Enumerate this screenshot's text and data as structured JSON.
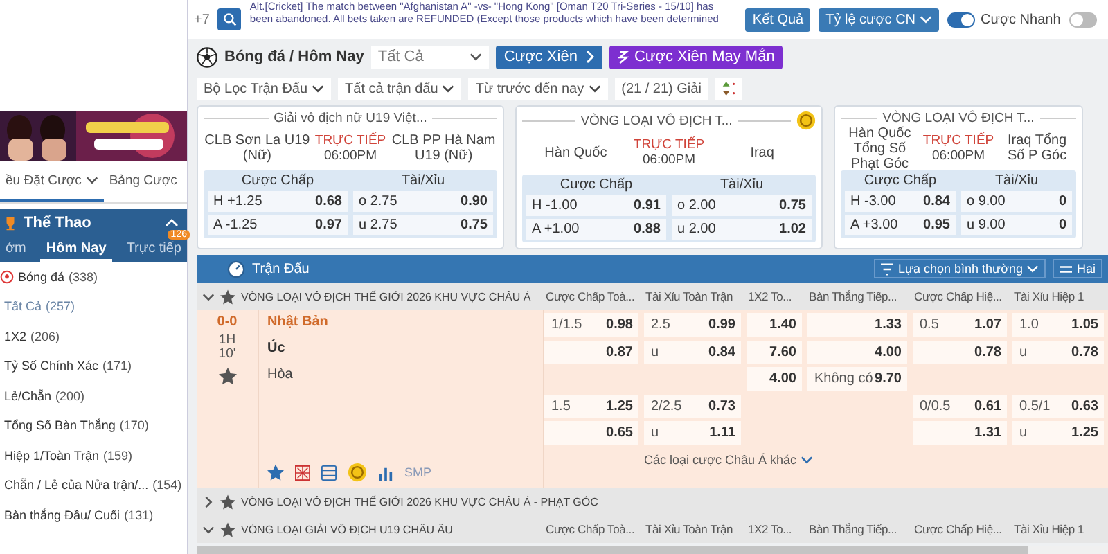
{
  "top_bar": {
    "more_count": "+7",
    "ticker": "Alt.[Cricket] The match between \"Afghanistan A\" -vs- \"Hong Kong\" [Oman T20 Tri-Series - 15/10] has been abandoned. All bets taken are REFUNDED (Except those products which have been determined",
    "buttons": [
      {
        "label": "Kết Quả",
        "kind": "plain"
      },
      {
        "label": "Tỷ lệ cược CN",
        "kind": "dropdown"
      }
    ],
    "toggles": [
      {
        "label": "Cược Nhanh",
        "on": true
      },
      {
        "on": false
      }
    ]
  },
  "sidebar": {
    "tabs": [
      {
        "label": "ều Đặt Cược",
        "selected": true,
        "dropdown": true
      },
      {
        "label": "Bảng Cược",
        "selected": false,
        "dropdown": false
      }
    ],
    "section": {
      "title": "Thể Thao",
      "expanded": true
    },
    "day_tabs": [
      {
        "label": "ớm",
        "selected": false
      },
      {
        "label": "Hôm Nay",
        "selected": true
      },
      {
        "label": "Trực tiếp",
        "badge": "126",
        "selected": false
      }
    ],
    "sport": {
      "label": "Bóng đá",
      "count": "(338)"
    },
    "markets": [
      {
        "label": "Tất Cả",
        "count": "(257)",
        "selected": true
      },
      {
        "label": "1X2",
        "count": "(206)",
        "selected": false
      },
      {
        "label": "Tỷ Số Chính Xác",
        "count": "(171)",
        "selected": false
      },
      {
        "label": "Lẻ/Chẵn",
        "count": "(200)",
        "selected": false
      },
      {
        "label": "Tổng Số Bàn Thắng",
        "count": "(170)",
        "selected": false
      },
      {
        "label": "Hiệp 1/Toàn Trận",
        "count": "(159)",
        "selected": false
      },
      {
        "label": "Chẵn / Lẻ của Nửa trận/...",
        "count": "(154)",
        "selected": false
      },
      {
        "label": "Bàn thắng Đầu/ Cuối",
        "count": "(131)",
        "selected": false
      }
    ]
  },
  "toolbar": {
    "breadcrumb": "Bóng đá / Hôm Nay",
    "market_select": "Tất Cả",
    "parlay_buttons": [
      {
        "label": "Cược Xiên",
        "kind": "parlay"
      },
      {
        "label": "Cược Xiên May Mắn",
        "kind": "lucky"
      }
    ]
  },
  "filters": [
    {
      "label": "Bộ Lọc Trận Đấu",
      "dropdown": true
    },
    {
      "label": "Tất cả trận đấu",
      "dropdown": true
    },
    {
      "label": "Từ trước đến nay",
      "dropdown": true
    },
    {
      "label": "(21 / 21) Giải",
      "dropdown": false
    }
  ],
  "featured": [
    {
      "league": "Giải vô địch nữ U19 Việt...",
      "home": "CLB Sơn La U19 (Nữ)",
      "status": "TRỰC TIẾP",
      "time": "06:00PM",
      "away": "CLB PP Hà Nam U19 (Nữ)",
      "cashout": false,
      "handicap_title": "Cược Chấp",
      "total_title": "Tài/Xỉu",
      "handicap": [
        {
          "line": "H +1.25",
          "price": "0.68"
        },
        {
          "line": "A -1.25",
          "price": "0.97"
        }
      ],
      "total": [
        {
          "line": "o 2.75",
          "price": "0.90"
        },
        {
          "line": "u 2.75",
          "price": "0.75"
        }
      ]
    },
    {
      "league": "VÒNG LOẠI VÔ ĐỊCH T...",
      "home": "Hàn Quốc",
      "status": "TRỰC TIẾP",
      "time": "06:00PM",
      "away": "Iraq",
      "cashout": true,
      "handicap_title": "Cược Chấp",
      "total_title": "Tài/Xỉu",
      "handicap": [
        {
          "line": "H -1.00",
          "price": "0.91"
        },
        {
          "line": "A +1.00",
          "price": "0.88"
        }
      ],
      "total": [
        {
          "line": "o 2.00",
          "price": "0.75"
        },
        {
          "line": "u 2.00",
          "price": "1.02"
        }
      ]
    },
    {
      "league": "VÒNG LOẠI VÔ ĐỊCH T...",
      "home": "Hàn Quốc Tổng Số Phạt Góc",
      "status": "TRỰC TIẾP",
      "time": "06:00PM",
      "away": "Iraq Tổng Số P Góc",
      "cashout": false,
      "handicap_title": "Cược Chấp",
      "total_title": "Tài/Xỉu",
      "handicap": [
        {
          "line": "H -3.00",
          "price": "0.84"
        },
        {
          "line": "A +3.00",
          "price": "0.95"
        }
      ],
      "total": [
        {
          "line": "o 9.00",
          "price": "0"
        },
        {
          "line": "u 9.00",
          "price": "0"
        }
      ]
    }
  ],
  "matches_panel": {
    "title": "Trận Đấu",
    "view_select": "Lựa chọn bình thường",
    "view_select_2": "Hai",
    "leagues": [
      {
        "title": "VÒNG LOẠI VÔ ĐỊCH THẾ GIỚI 2026 KHU VỰC CHÂU Á",
        "expanded": true,
        "columns": [
          "Cược Chấp Toà...",
          "Tài Xỉu Toàn Trận",
          "1X2 To...",
          "Bàn Thắng Tiếp...",
          "Cược Chấp Hiệ...",
          "Tài Xỉu Hiệp 1"
        ],
        "matches": [
          {
            "score": "0-0",
            "period": "1H",
            "minute": "10'",
            "home": "Nhật Bản",
            "away": "Úc",
            "draw": "Hòa",
            "stats_label": "SMP",
            "more_link": "Các loại cược Châu Á khác",
            "odds": [
              [
                {
                  "kind": "odds",
                  "line": "1/1.5",
                  "price": "0.98"
                },
                {
                  "kind": "odds",
                  "line": "2.5",
                  "price": "0.99"
                },
                {
                  "kind": "odds",
                  "price": "1.40"
                },
                {
                  "kind": "odds",
                  "price": "1.33"
                },
                {
                  "kind": "odds",
                  "line": "0.5",
                  "price": "1.07"
                },
                {
                  "kind": "odds",
                  "line": "1.0",
                  "price": "1.05"
                }
              ],
              [
                {
                  "kind": "odds",
                  "price": "0.87"
                },
                {
                  "kind": "odds",
                  "line": "u",
                  "price": "0.84"
                },
                {
                  "kind": "odds",
                  "price": "7.60"
                },
                {
                  "kind": "odds",
                  "price": "4.00"
                },
                {
                  "kind": "odds",
                  "price": "0.78"
                },
                {
                  "kind": "odds",
                  "line": "u",
                  "price": "0.78"
                }
              ],
              [
                {
                  "kind": "blank"
                },
                {
                  "kind": "blank"
                },
                {
                  "kind": "odds",
                  "price": "4.00"
                },
                {
                  "kind": "odds",
                  "line": "Không có",
                  "price": "9.70"
                },
                {
                  "kind": "blank"
                },
                {
                  "kind": "blank"
                }
              ],
              [
                {
                  "kind": "odds",
                  "line": "1.5",
                  "price": "1.25"
                },
                {
                  "kind": "odds",
                  "line": "2/2.5",
                  "price": "0.73"
                },
                {
                  "kind": "blank"
                },
                {
                  "kind": "blank"
                },
                {
                  "kind": "odds",
                  "line": "0/0.5",
                  "price": "0.61"
                },
                {
                  "kind": "odds",
                  "line": "0.5/1",
                  "price": "0.63"
                }
              ],
              [
                {
                  "kind": "odds",
                  "price": "0.65"
                },
                {
                  "kind": "odds",
                  "line": "u",
                  "price": "1.11"
                },
                {
                  "kind": "blank"
                },
                {
                  "kind": "blank"
                },
                {
                  "kind": "odds",
                  "price": "1.31"
                },
                {
                  "kind": "odds",
                  "line": "u",
                  "price": "1.25"
                }
              ]
            ]
          }
        ]
      },
      {
        "title": "VÒNG LOẠI VÔ ĐỊCH THẾ GIỚI 2026 KHU VỰC CHÂU Á - PHẠT GÓC",
        "expanded": false
      },
      {
        "title": "VÒNG LOẠI GIẢI VÔ ĐỊCH U19 CHÂU ÂU",
        "expanded": true,
        "columns": [
          "Cược Chấp Toà...",
          "Tài Xỉu Toàn Trận",
          "1X2 To...",
          "Bàn Thắng Tiếp...",
          "Cược Chấp Hiệ...",
          "Tài Xỉu Hiệp 1"
        ]
      }
    ]
  }
}
